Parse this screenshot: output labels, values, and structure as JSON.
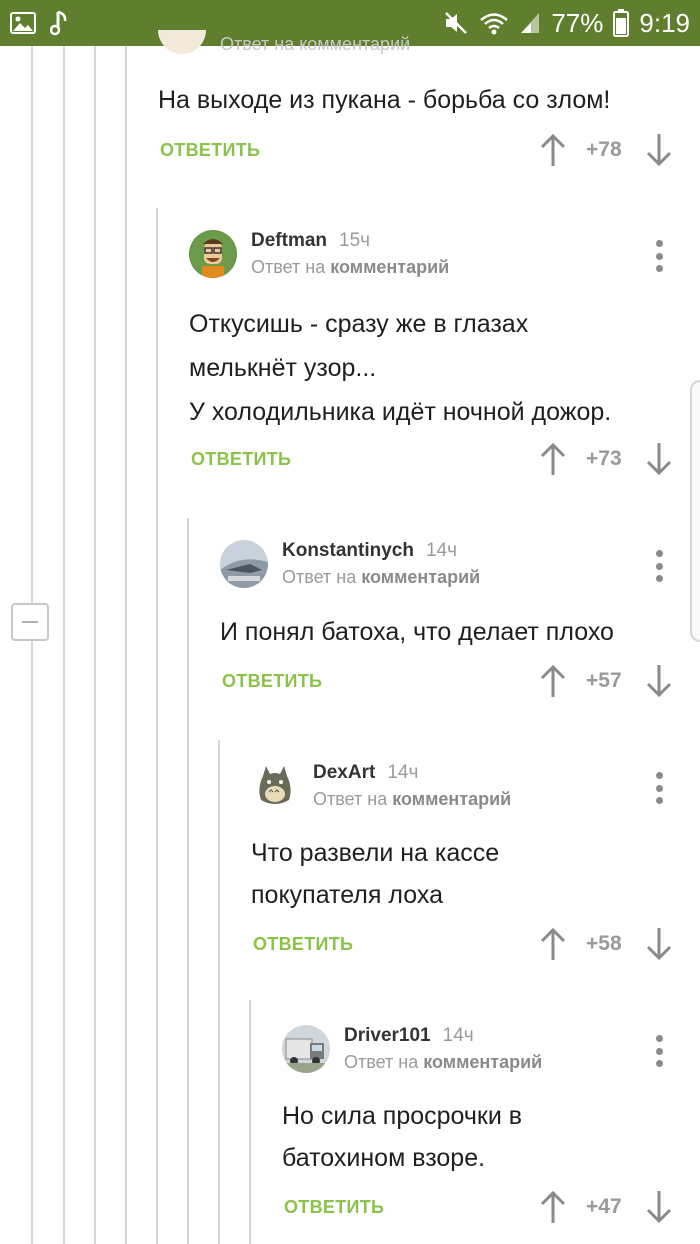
{
  "status_bar": {
    "battery": "77%",
    "time": "9:19",
    "icons": [
      "image-icon",
      "music-note-icon",
      "mute-icon",
      "wifi-icon",
      "signal-icon",
      "battery-icon"
    ]
  },
  "top_comment": {
    "meta_partial": "Ответ на комментарий",
    "text": "На выходе из пукана - борьба со злом!",
    "reply_label": "ОТВЕТИТЬ",
    "score": "+78"
  },
  "comments": [
    {
      "author": "Deftman",
      "time": "15ч",
      "reply_prefix": "Ответ на",
      "reply_target": "комментарий",
      "text": "Откусишь - сразу же в глазах\nмелькнёт узор...\nУ холодильника идёт ночной дожор.",
      "reply_label": "ОТВЕТИТЬ",
      "score": "+73"
    },
    {
      "author": "Konstantinych",
      "time": "14ч",
      "reply_prefix": "Ответ на",
      "reply_target": "комментарий",
      "text": "И понял батоха, что делает плохо",
      "reply_label": "ОТВЕТИТЬ",
      "score": "+57"
    },
    {
      "author": "DexArt",
      "time": "14ч",
      "reply_prefix": "Ответ на",
      "reply_target": "комментарий",
      "text": "Что развели на кассе\nпокупателя лоха",
      "reply_label": "ОТВЕТИТЬ",
      "score": "+58"
    },
    {
      "author": "Driver101",
      "time": "14ч",
      "reply_prefix": "Ответ на",
      "reply_target": "комментарий",
      "text": "Но сила просрочки в\nбатохином взоре.",
      "reply_label": "ОТВЕТИТЬ",
      "score": "+47"
    }
  ],
  "colors": {
    "status_bar": "#5f7e2e",
    "reply_green": "#8bc34a",
    "muted_text": "#9a9a9a"
  }
}
